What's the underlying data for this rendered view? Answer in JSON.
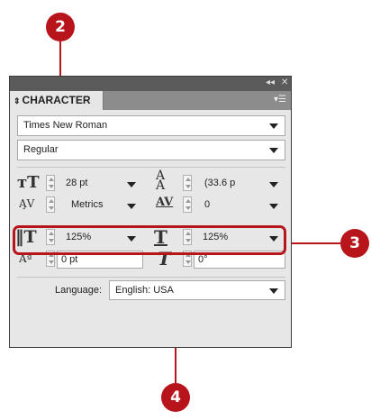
{
  "callouts": [
    "2",
    "3",
    "4"
  ],
  "panel": {
    "tab_label": "CHARACTER",
    "font_family": "Times New Roman",
    "font_style": "Regular",
    "font_size": "28 pt",
    "leading": "(33.6 p",
    "kerning": "Metrics",
    "tracking": "0",
    "vertical_scale": "125%",
    "horizontal_scale": "125%",
    "baseline_shift": "0 pt",
    "skew": "0°",
    "language_label": "Language:",
    "language_value": "English: USA"
  }
}
